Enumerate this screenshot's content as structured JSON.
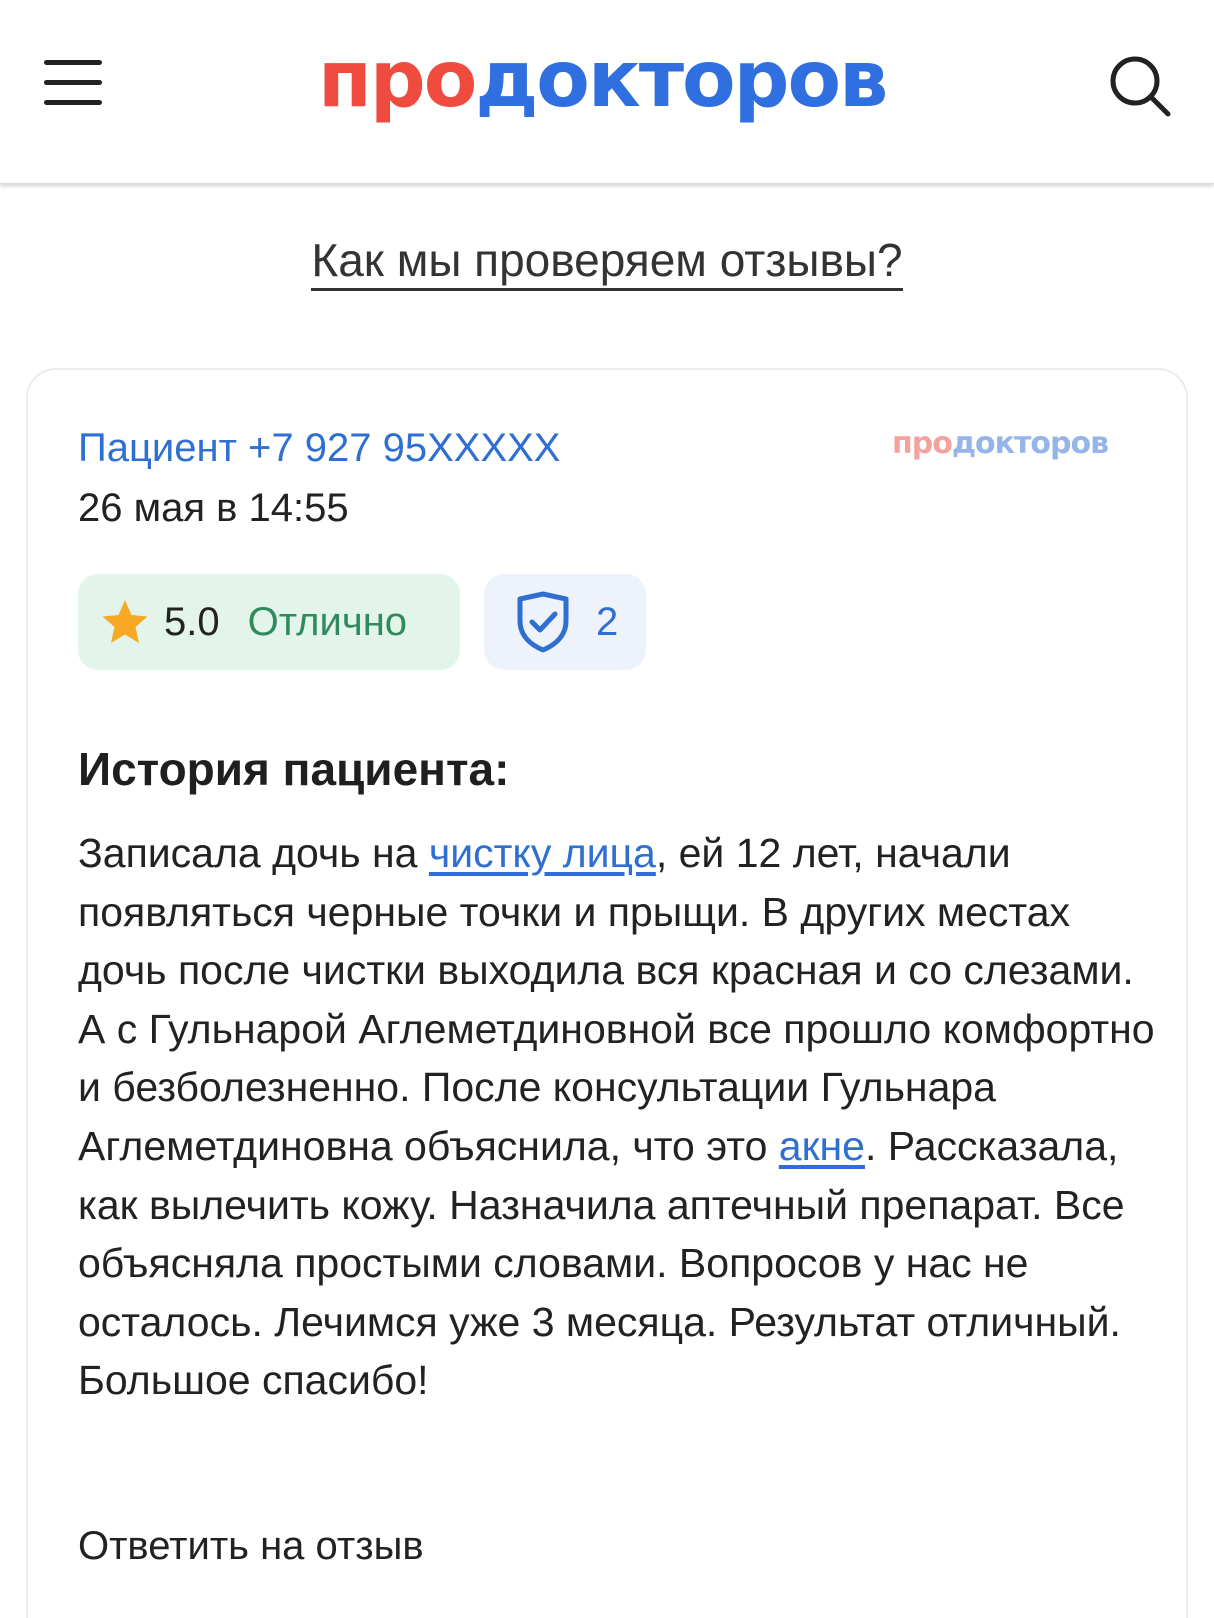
{
  "header": {
    "logo_part1": "про",
    "logo_part2": "докторов",
    "menu_icon": "hamburger-menu-icon",
    "search_icon": "search-icon"
  },
  "verify_link": "Как мы проверяем отзывы?",
  "review": {
    "author": "Пациент +7 927 95XXXXX",
    "date": "26 мая в 14:55",
    "watermark_part1": "про",
    "watermark_part2": "докторов",
    "rating_score": "5.0",
    "rating_label": "Отлично",
    "verified_count": "2",
    "story_title": "История пациента:",
    "story": {
      "t1": "Записала дочь на ",
      "link1": "чистку лица",
      "t2": ", ей 12 лет, начали появляться черные точки и прыщи. В других местах дочь после чистки выходила вся красная и со слезами. А с Гульнарой Аглеметдиновной все прошло комфортно и безболезненно. После консультации Гульнара Аглеметдиновна объяснила, что это ",
      "link2": "акне",
      "t3": ". Рассказала, как вылечить кожу. Назначила аптечный препарат. Все объясняла простыми словами. Вопросов у нас не осталось. Лечимся уже 3 месяца. Результат отличный. Большое спасибо!"
    },
    "reply_label": "Ответить на отзыв"
  },
  "colors": {
    "brand_red": "#ef4b3f",
    "brand_blue": "#2f6fe0",
    "link_blue": "#2f6fd1",
    "rating_bg": "#e3f4ea",
    "rating_text": "#2f8a5e",
    "star": "#f7a825"
  }
}
